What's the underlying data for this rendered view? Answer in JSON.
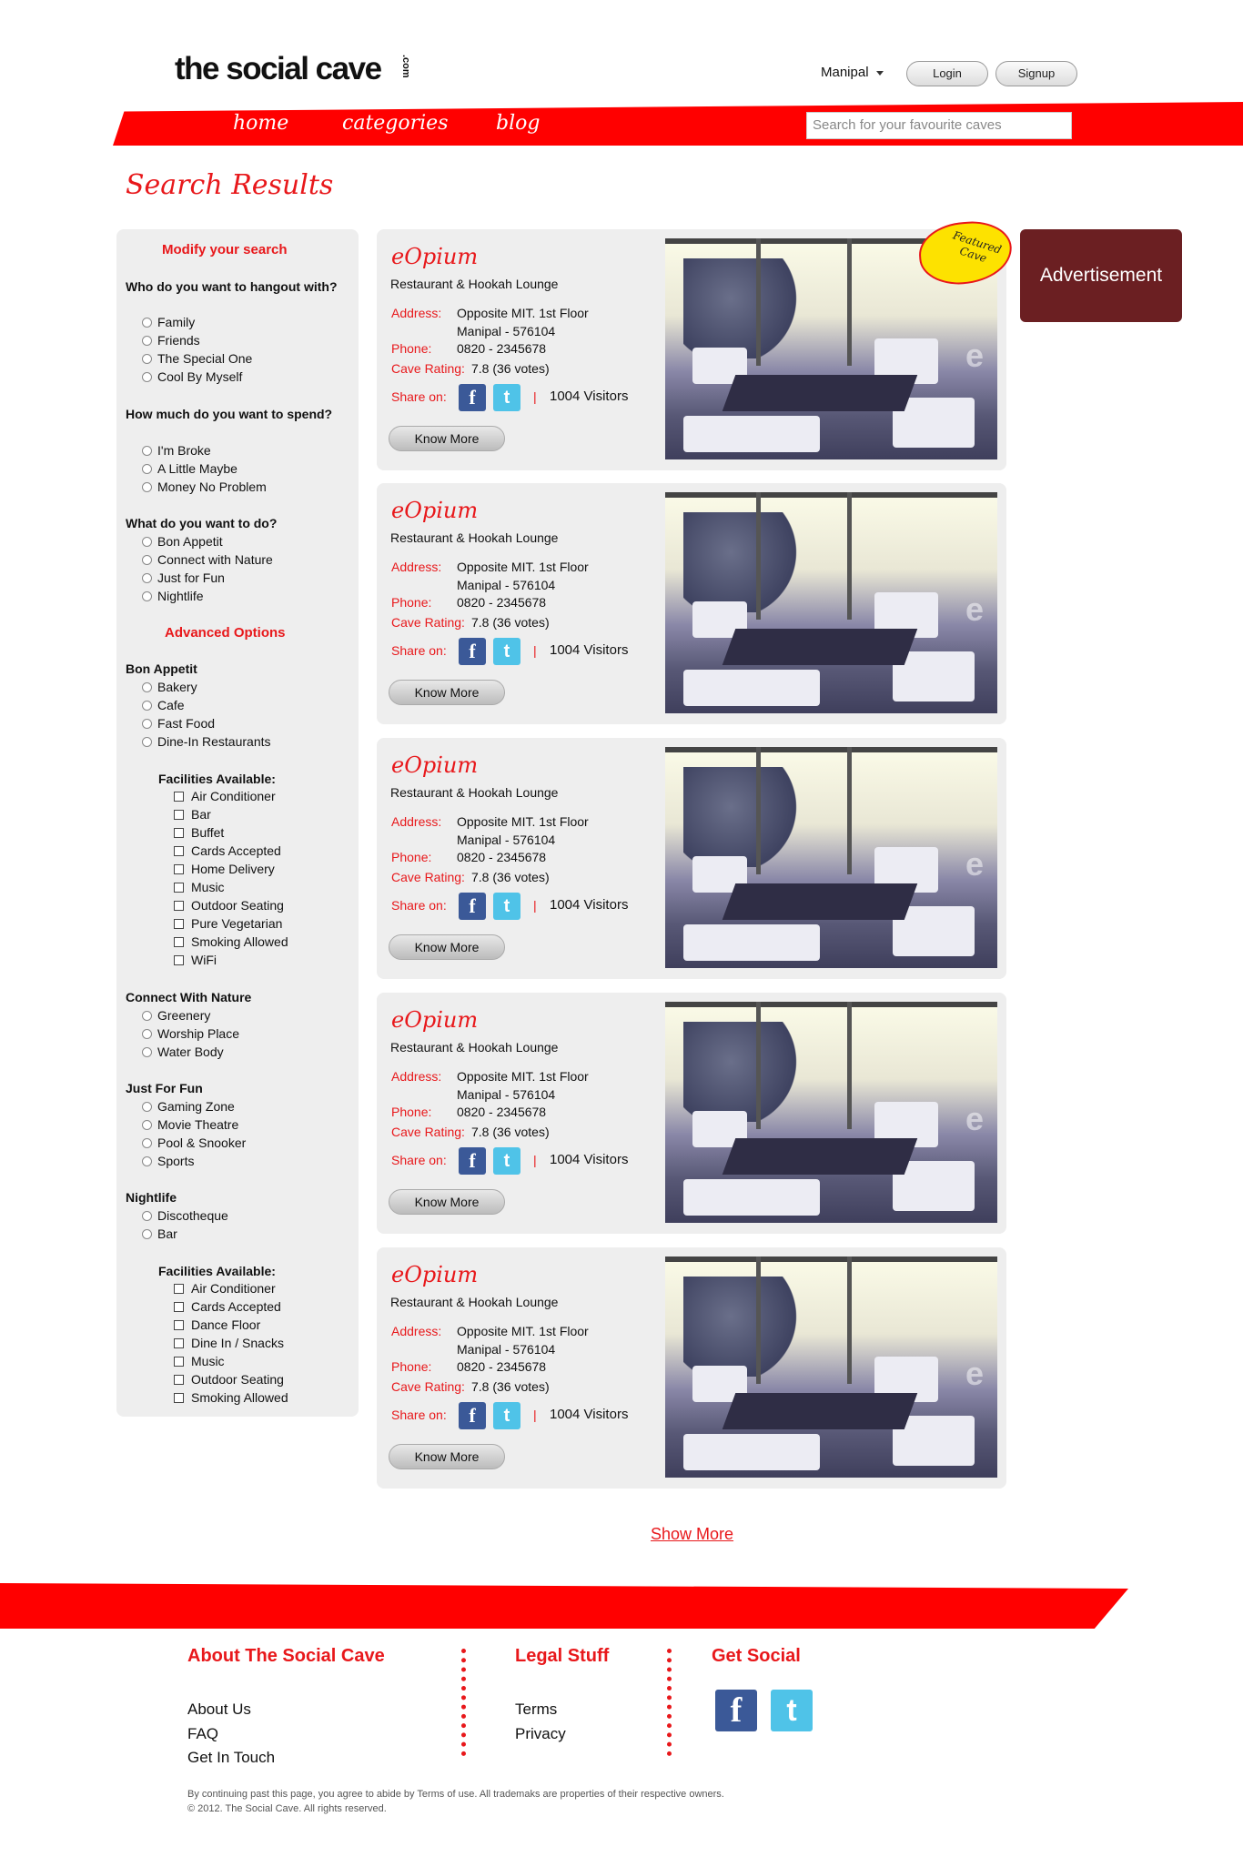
{
  "header": {
    "logo": "the social cave",
    "logo_suffix": ".com",
    "location": "Manipal",
    "login": "Login",
    "signup": "Signup"
  },
  "nav": {
    "home": "home",
    "categories": "categories",
    "blog": "blog",
    "search_placeholder": "Search for your favourite caves"
  },
  "page_title": "Search Results",
  "sidebar": {
    "modify_title": "Modify your search",
    "q1": "Who do you want to hangout with?",
    "q1_options": [
      "Family",
      "Friends",
      "The Special One",
      "Cool By Myself"
    ],
    "q2": "How much do you want to spend?",
    "q2_options": [
      "I'm Broke",
      "A Little Maybe",
      "Money No Problem"
    ],
    "q3": "What do you want to do?",
    "q3_options": [
      "Bon Appetit",
      "Connect with Nature",
      "Just for Fun",
      "Nightlife"
    ],
    "advanced_title": "Advanced Options",
    "bon_appetit": "Bon Appetit",
    "bon_appetit_options": [
      "Bakery",
      "Cafe",
      "Fast Food",
      "Dine-In Restaurants"
    ],
    "facilities_label": "Facilities Available:",
    "bon_appetit_facilities": [
      "Air Conditioner",
      "Bar",
      "Buffet",
      "Cards Accepted",
      "Home Delivery",
      "Music",
      "Outdoor Seating",
      "Pure Vegetarian",
      "Smoking Allowed",
      "WiFi"
    ],
    "nature": "Connect With Nature",
    "nature_options": [
      "Greenery",
      "Worship Place",
      "Water Body"
    ],
    "fun": "Just For Fun",
    "fun_options": [
      "Gaming Zone",
      "Movie Theatre",
      "Pool & Snooker",
      "Sports"
    ],
    "nightlife": "Nightlife",
    "nightlife_options": [
      "Discotheque",
      "Bar"
    ],
    "nightlife_facilities": [
      "Air Conditioner",
      "Cards Accepted",
      "Dance Floor",
      "Dine In / Snacks",
      "Music",
      "Outdoor Seating",
      "Smoking Allowed"
    ]
  },
  "results": [
    {
      "name": "eOpium",
      "type": "Restaurant & Hookah Lounge",
      "address_label": "Address:",
      "address1": "Opposite MIT. 1st Floor",
      "address2": "Manipal - 576104",
      "phone_label": "Phone:",
      "phone": "0820 - 2345678",
      "rating_label": "Cave Rating:",
      "rating": "7.8  (36 votes)",
      "share_label": "Share on:",
      "visitors": "1004 Visitors",
      "more": "Know More"
    },
    {
      "name": "eOpium",
      "type": "Restaurant & Hookah Lounge",
      "address_label": "Address:",
      "address1": "Opposite MIT. 1st Floor",
      "address2": "Manipal - 576104",
      "phone_label": "Phone:",
      "phone": "0820 - 2345678",
      "rating_label": "Cave Rating:",
      "rating": "7.8  (36 votes)",
      "share_label": "Share on:",
      "visitors": "1004 Visitors",
      "more": "Know More"
    },
    {
      "name": "eOpium",
      "type": "Restaurant & Hookah Lounge",
      "address_label": "Address:",
      "address1": "Opposite MIT. 1st Floor",
      "address2": "Manipal - 576104",
      "phone_label": "Phone:",
      "phone": "0820 - 2345678",
      "rating_label": "Cave Rating:",
      "rating": "7.8  (36 votes)",
      "share_label": "Share on:",
      "visitors": "1004 Visitors",
      "more": "Know More"
    },
    {
      "name": "eOpium",
      "type": "Restaurant & Hookah Lounge",
      "address_label": "Address:",
      "address1": "Opposite MIT. 1st Floor",
      "address2": "Manipal - 576104",
      "phone_label": "Phone:",
      "phone": "0820 - 2345678",
      "rating_label": "Cave Rating:",
      "rating": "7.8  (36 votes)",
      "share_label": "Share on:",
      "visitors": "1004 Visitors",
      "more": "Know More"
    },
    {
      "name": "eOpium",
      "type": "Restaurant & Hookah Lounge",
      "address_label": "Address:",
      "address1": "Opposite MIT. 1st Floor",
      "address2": "Manipal - 576104",
      "phone_label": "Phone:",
      "phone": "0820 - 2345678",
      "rating_label": "Cave Rating:",
      "rating": "7.8  (36 votes)",
      "share_label": "Share on:",
      "visitors": "1004 Visitors",
      "more": "Know More"
    }
  ],
  "featured_badge": "Featured Cave",
  "advertisement": "Advertisement",
  "show_more": "Show More",
  "footer": {
    "about_title": "About The Social Cave",
    "about_links": [
      "About Us",
      "FAQ",
      "Get In Touch"
    ],
    "legal_title": "Legal Stuff",
    "legal_links": [
      "Terms",
      "Privacy"
    ],
    "social_title": "Get Social",
    "disclaimer": "By continuing past this page, you agree to abide by Terms of use. All trademaks are properties of their respective owners.",
    "copyright": "© 2012. The Social Cave. All rights reserved."
  },
  "colors": {
    "brand_red": "#e8181b",
    "band_red": "#ff0000",
    "ad_bg": "#6b1f22",
    "panel_bg": "#eeeeee",
    "facebook": "#3b5998",
    "twitter": "#4fc3e8",
    "featured_yellow": "#fde200"
  },
  "icons": [
    "dropdown-caret-icon",
    "facebook-icon",
    "twitter-icon",
    "radio-icon",
    "checkbox-icon"
  ]
}
